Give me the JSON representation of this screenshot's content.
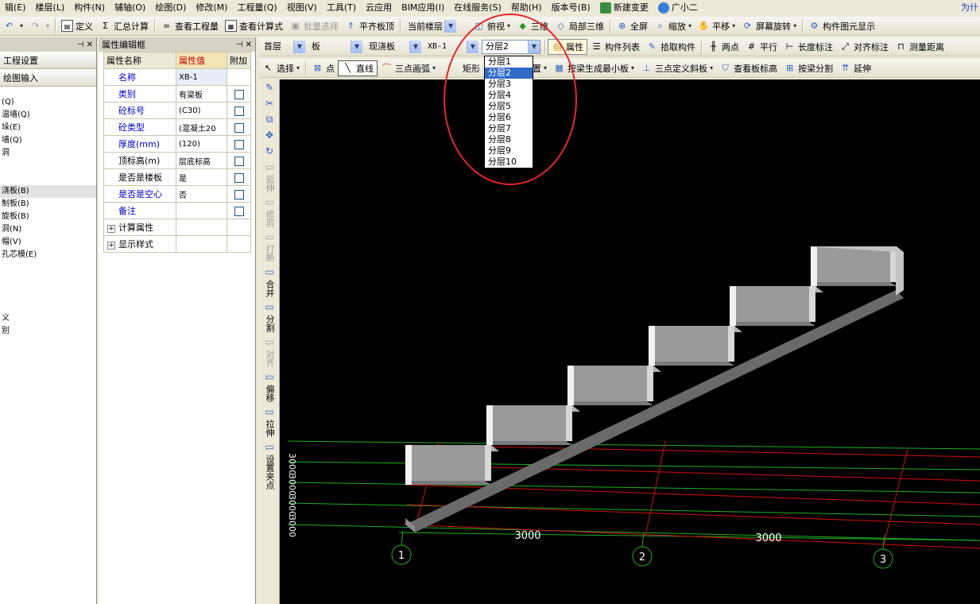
{
  "menu": {
    "items": [
      "辑(E)",
      "楼层(L)",
      "构件(N)",
      "辅轴(O)",
      "绘图(D)",
      "修改(M)",
      "工程量(Q)",
      "视图(V)",
      "工具(T)",
      "云应用",
      "BIM应用(I)",
      "在线服务(S)",
      "帮助(H)",
      "版本号(B)",
      "新建变更",
      "广小二"
    ],
    "right_text": "为什"
  },
  "toolbar1": {
    "define": "定义",
    "sum_calc": "汇总计算",
    "view_quantity": "查看工程量",
    "view_formula": "查看计算式",
    "batch_select": "批量选择",
    "align_slab_top": "平齐板顶",
    "current_floor_label": "当前楼层",
    "top_view": "俯视",
    "three_d": "三维",
    "local_3d": "局部三维",
    "fullscreen": "全屏",
    "zoom": "缩放",
    "pan": "平移",
    "screen_rotate": "屏幕旋转",
    "component_display": "构件图元显示"
  },
  "toolbar2": {
    "floor": "首层",
    "category": "板",
    "type": "现浇板",
    "component": "XB-1",
    "sublayer": "分层2",
    "properties": "属性",
    "component_list": "构件列表",
    "pick_component": "拾取构件",
    "two_points": "两点",
    "parallel": "平行",
    "length_mark": "长度标注",
    "align_mark": "对齐标注",
    "measure_distance": "测量距离"
  },
  "toolbar3": {
    "select": "选择",
    "point": "点",
    "line": "直线",
    "three_point_arc": "三点画弧",
    "rectangle": "矩形",
    "smart_layout": "智能布置",
    "generate_min_slab": "按梁生成最小板",
    "three_point_slope": "三点定义斜板",
    "view_slab_elev": "查看板标高",
    "split_by_beam": "按梁分割",
    "extend": "延伸"
  },
  "nav_panel": {
    "project_settings": "工程设置",
    "drawing_input": "绘图输入",
    "tree": [
      "(Q)",
      "温墙(Q)",
      "垛(E)",
      "墙(Q)",
      "洞",
      "",
      "",
      "浇板(B)",
      "制板(B)",
      "旋板(B)",
      "洞(N)",
      "帽(V)",
      "孔芯模(E)",
      "",
      "",
      "",
      "",
      "义",
      "别"
    ]
  },
  "prop_panel": {
    "title": "属性编辑框",
    "headers": [
      "属性名称",
      "属性值",
      "附加"
    ],
    "rows": [
      {
        "name": "名称",
        "value": "XB-1",
        "checkbox": false
      },
      {
        "name": "类别",
        "value": "有梁板",
        "checkbox": true
      },
      {
        "name": "砼标号",
        "value": "(C30)",
        "checkbox": true
      },
      {
        "name": "砼类型",
        "value": "(混凝土20",
        "checkbox": true
      },
      {
        "name": "厚度(mm)",
        "value": "(120)",
        "checkbox": true
      },
      {
        "name": "顶标高(m)",
        "value": "层底标高",
        "checkbox": true
      },
      {
        "name": "是否是楼板",
        "value": "是",
        "checkbox": true
      },
      {
        "name": "是否是空心",
        "value": "否",
        "checkbox": true
      },
      {
        "name": "备注",
        "value": "",
        "checkbox": true
      }
    ],
    "groups": [
      "计算属性",
      "显示样式"
    ]
  },
  "vertical_tools": [
    "延伸",
    "修剪",
    "打断",
    "合并",
    "分割",
    "对齐",
    "偏移",
    "拉伸",
    "设置夹点"
  ],
  "floor_dropdown": {
    "options": [
      "分层1",
      "分层2",
      "分层3",
      "分层4",
      "分层5",
      "分层6",
      "分层7",
      "分层8",
      "分层9",
      "分层10"
    ],
    "selected": "分层2"
  },
  "canvas": {
    "axis_labels": [
      "1",
      "2",
      "3"
    ],
    "dimensions": [
      "3000",
      "3000"
    ],
    "left_dims": [
      "3000",
      "3000",
      "3000",
      "3000"
    ],
    "colors": {
      "grid_green": "#1fae1f",
      "grid_red": "#d01010",
      "background": "#000000",
      "slab": "#9a9a9a"
    }
  }
}
